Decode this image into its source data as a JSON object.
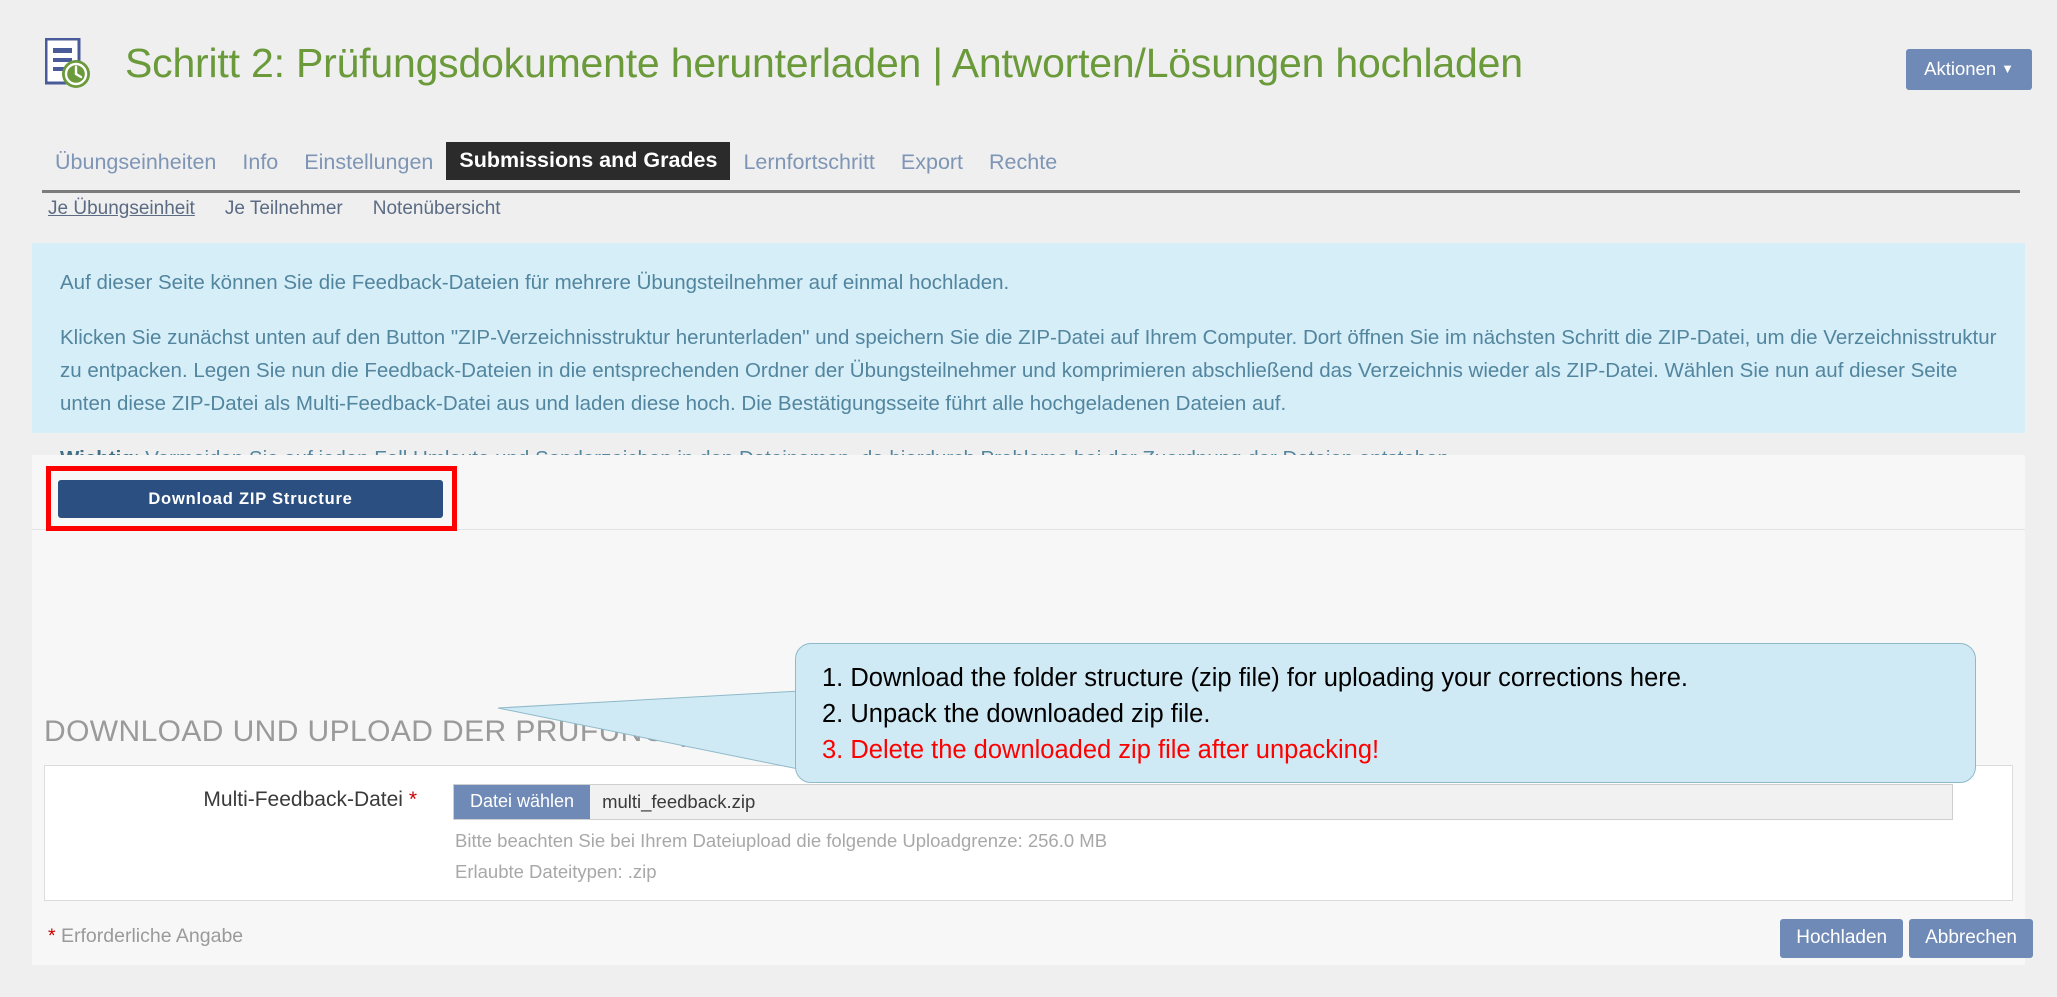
{
  "header": {
    "icon": "document-clock-icon",
    "title": "Schritt 2: Prüfungsdokumente herunterladen | Antworten/Lösungen hochladen",
    "title_color": "#6a9a3a",
    "actions_label": "Aktionen",
    "caret": "▼"
  },
  "tabs": [
    {
      "label": "Übungseinheiten",
      "active": false
    },
    {
      "label": "Info",
      "active": false
    },
    {
      "label": "Einstellungen",
      "active": false
    },
    {
      "label": "Submissions and Grades",
      "active": true
    },
    {
      "label": "Lernfortschritt",
      "active": false
    },
    {
      "label": "Export",
      "active": false
    },
    {
      "label": "Rechte",
      "active": false
    }
  ],
  "subnav": [
    {
      "label": "Je Übungseinheit",
      "active": true
    },
    {
      "label": "Je Teilnehmer",
      "active": false
    },
    {
      "label": "Notenübersicht",
      "active": false
    }
  ],
  "info_box": {
    "background": "#d6eef8",
    "paragraph_1": "Auf dieser Seite können Sie die Feedback-Dateien für mehrere Übungsteilnehmer auf einmal hochladen.",
    "paragraph_2": "Klicken Sie zunächst unten auf den Button \"ZIP-Verzeichnisstruktur herunterladen\" und speichern Sie die ZIP-Datei auf Ihrem Computer. Dort öffnen Sie im nächsten Schritt die ZIP-Datei, um die Verzeichnisstruktur zu entpacken. Legen Sie nun die Feedback-Dateien in die entsprechenden Ordner der Übungsteilnehmer und komprimieren abschließend das Verzeichnis wieder als ZIP-Datei. Wählen Sie nun auf dieser Seite unten diese ZIP-Datei als Multi-Feedback-Datei aus und laden diese hoch. Die Bestätigungsseite führt alle hochgeladenen Dateien auf.",
    "paragraph_3_bold": "Wichtig",
    "paragraph_3_rest": ": Vermeiden Sie auf jeden Fall Umlaute und Sonderzeichen in den Dateinamen, da hierdurch Probleme bei der Zuordnung der Dateien entstehen."
  },
  "download": {
    "button_label": "Download ZIP Structure",
    "button_color": "#2b4f81",
    "highlight_color": "#ff0000"
  },
  "section": {
    "heading": "DOWNLOAD UND UPLOAD DER PRÜFUNG (VERPFLICHTEND)"
  },
  "form": {
    "label": "Multi-Feedback-Datei",
    "required_marker": "*",
    "file_button_label": "Datei wählen",
    "file_name": "multi_feedback.zip",
    "hint_upload_limit": "Bitte beachten Sie bei Ihrem Dateiupload die folgende Uploadgrenze: 256.0 MB",
    "hint_file_types": "Erlaubte Dateitypen: .zip"
  },
  "footer": {
    "required_note_star": "*",
    "required_note": "Erforderliche Angabe",
    "upload_label": "Hochladen",
    "cancel_label": "Abbrechen",
    "button_color": "#6f8ab6"
  },
  "callout": {
    "background": "#cfeaf5",
    "line_1": "1. Download the folder structure (zip file) for uploading your corrections here.",
    "line_2": "2. Unpack the downloaded zip file.",
    "line_3": "3. Delete the downloaded zip file after unpacking!",
    "line_3_color": "#ff0000"
  }
}
